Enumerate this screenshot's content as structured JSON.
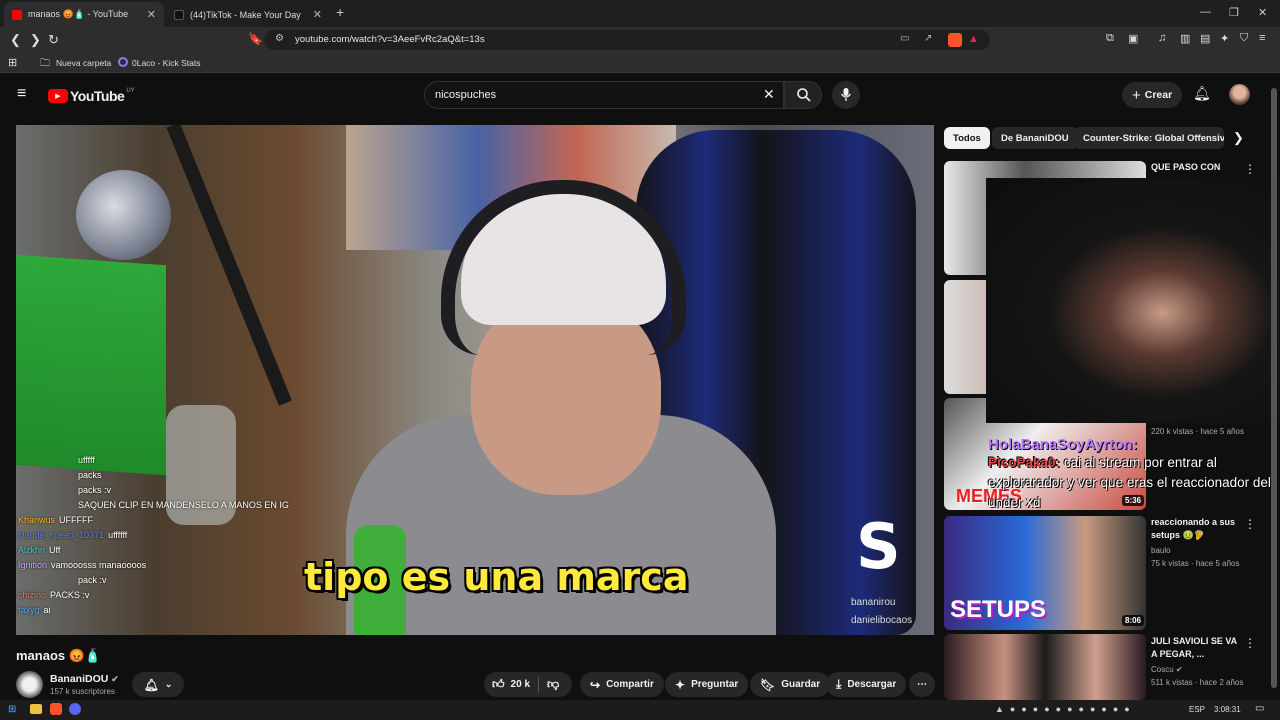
{
  "browser": {
    "tabs": [
      {
        "title": "manaos 😡🧴 - YouTube"
      },
      {
        "title": "(44)TikTok - Make Your Day"
      }
    ],
    "url": "youtube.com/watch?v=3AeeFvRc2aQ&t=13s",
    "bookmarks": [
      "Nueva carpeta",
      "0Laco - Kick Stats"
    ]
  },
  "header": {
    "logo_text": "YouTube",
    "region": "UY",
    "search_value": "nicospuches",
    "create_label": "Crear"
  },
  "video": {
    "caption": "tipo es una marca",
    "watermark_letter": "S",
    "watermark_handles": [
      "bananirou",
      "danielibocaos"
    ],
    "chat": [
      {
        "user": "",
        "msg": "ufffff"
      },
      {
        "user": "",
        "msg": "packs"
      },
      {
        "user": "",
        "msg": "packs :v"
      },
      {
        "user": "",
        "msg": "SAQUEN CLIP EN MANDENSELO A MANOS EN IG"
      },
      {
        "user": "Khanwus",
        "msg": "UFFFFF"
      },
      {
        "user": "claude_speed_10371",
        "msg": "uffffff"
      },
      {
        "user": "Alzkhn",
        "msg": "Uff"
      },
      {
        "user": "Ignition",
        "msg": "vamooosss manaoooos"
      },
      {
        "user": "",
        "msg": "pack :v"
      },
      {
        "user": "chizino",
        "msg": "PACKS :v"
      },
      {
        "user": "faxyg",
        "msg": "ai"
      }
    ]
  },
  "below": {
    "title": "manaos 😡🧴",
    "channel": "BananiDOU",
    "subscribers": "157 k suscriptores",
    "likes": "20 k",
    "share": "Compartir",
    "ask": "Preguntar",
    "save": "Guardar",
    "download": "Descargar"
  },
  "sidebar": {
    "chips": [
      "Todos",
      "De BananiDOU",
      "Counter-Strike: Global Offensive"
    ],
    "videos": [
      {
        "title": "QUE PASO CON",
        "channel": "",
        "meta": "",
        "duration": ""
      },
      {
        "title": "",
        "channel": "",
        "meta": "",
        "duration": ""
      },
      {
        "title": "",
        "channel": "",
        "meta": "220 k vistas · hace 5 años",
        "duration": "5:36"
      },
      {
        "title": "reaccionando a sus setups 🤢🦻",
        "channel": "baulo",
        "meta": "75 k vistas · hace 5 años",
        "duration": "8:06"
      },
      {
        "title": "JULI SAVIOLI SE VA A PEGAR, ...",
        "channel": "Coscu",
        "meta": "511 k vistas · hace 2 años",
        "duration": ""
      }
    ],
    "thumb_texts": [
      "MEMES",
      "SETUPS"
    ]
  },
  "overlay": {
    "chat_user": "HolaBanaSoyAyrton:",
    "chat_user2": "PicoPaka0:",
    "chat_msg": "cai al stream por entrar al explorarador y ver que eras el reaccionador del under xd"
  },
  "taskbar": {
    "lang": "ESP",
    "time": "3:08:31"
  },
  "colors": {
    "yt_red": "#ff0000",
    "caption_yellow": "#ffe93a"
  }
}
